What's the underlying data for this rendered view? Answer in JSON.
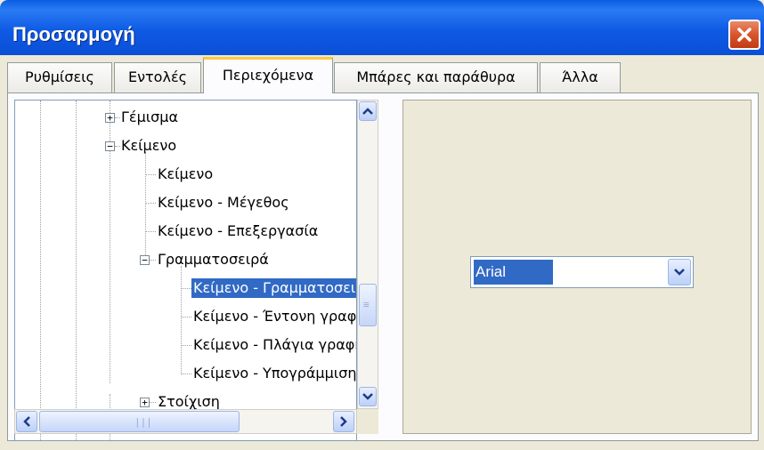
{
  "window": {
    "title": "Προσαρμογή"
  },
  "tabs": [
    {
      "label": "Ρυθμίσεις"
    },
    {
      "label": "Εντολές"
    },
    {
      "label": "Περιεχόμενα"
    },
    {
      "label": "Μπάρες και παράθυρα"
    },
    {
      "label": "Άλλα"
    }
  ],
  "tree": {
    "items": [
      {
        "label": "Γέμισμα",
        "expander": "+"
      },
      {
        "label": "Κείμενο",
        "expander": "−"
      },
      {
        "label": "Κείμενο"
      },
      {
        "label": "Κείμενο - Μέγεθος"
      },
      {
        "label": "Κείμενο - Επεξεργασία"
      },
      {
        "label": "Γραμματοσειρά",
        "expander": "−"
      },
      {
        "label": "Κείμενο - Γραμματοσειρά",
        "selected": true
      },
      {
        "label": "Κείμενο - Έντονη γραφή"
      },
      {
        "label": "Κείμενο - Πλάγια γραφή"
      },
      {
        "label": "Κείμενο - Υπογράμμιση"
      },
      {
        "label": "Στοίχιση",
        "expander": "+"
      }
    ]
  },
  "font_select": {
    "value": "Arial"
  },
  "colors": {
    "selection": "#316ac5",
    "titlebar": "#0a5de0",
    "close": "#d8552c"
  },
  "icons": [
    "close-icon",
    "arrow-up-icon",
    "arrow-down-icon",
    "arrow-left-icon",
    "arrow-right-icon",
    "chevron-down-icon",
    "expand-icon",
    "collapse-icon"
  ]
}
